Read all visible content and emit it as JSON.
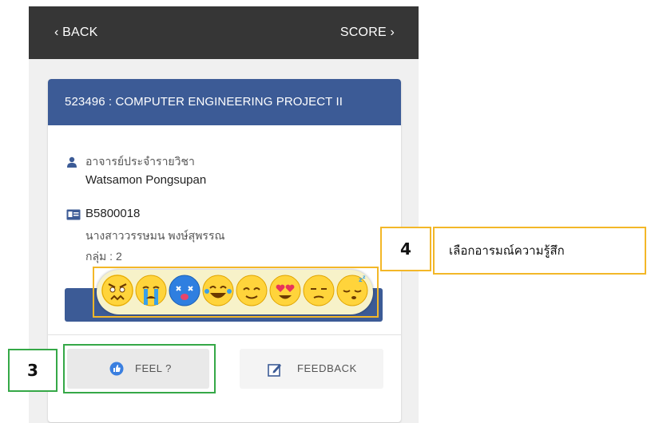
{
  "topbar": {
    "back_label": "‹ BACK",
    "score_label": "SCORE ›"
  },
  "course": {
    "title": "523496 : COMPUTER ENGINEERING PROJECT II"
  },
  "instructor": {
    "label": "อาจารย์ประจำรายวิชา",
    "name": "Watsamon Pongsupan",
    "icon": "user-icon"
  },
  "student": {
    "id": "B5800018",
    "name": "นางสาววรรษมน พงษ์สุพรรณ",
    "group": "กลุ่ม : 2",
    "icon": "id-card-icon"
  },
  "emotions": [
    {
      "name": "angry",
      "color": "#ffd43b"
    },
    {
      "name": "crying",
      "color": "#ffd43b"
    },
    {
      "name": "dizzy",
      "color": "#2f7fe0"
    },
    {
      "name": "laughing",
      "color": "#ffd43b"
    },
    {
      "name": "smiling",
      "color": "#ffd43b"
    },
    {
      "name": "heart-eyes",
      "color": "#ffd43b"
    },
    {
      "name": "unamused",
      "color": "#ffd43b"
    },
    {
      "name": "sleepy",
      "color": "#ffd43b"
    }
  ],
  "actions": {
    "feel_label": "FEEL ?",
    "feedback_label": "FEEDBACK"
  },
  "callouts": [
    {
      "number": "3"
    },
    {
      "number": "4",
      "text": "เลือกอารมณ์ความรู้สึก"
    }
  ],
  "colors": {
    "topbar": "#363636",
    "header": "#3c5b96",
    "callout_border": "#f3b728",
    "feel_border": "#35a847"
  }
}
